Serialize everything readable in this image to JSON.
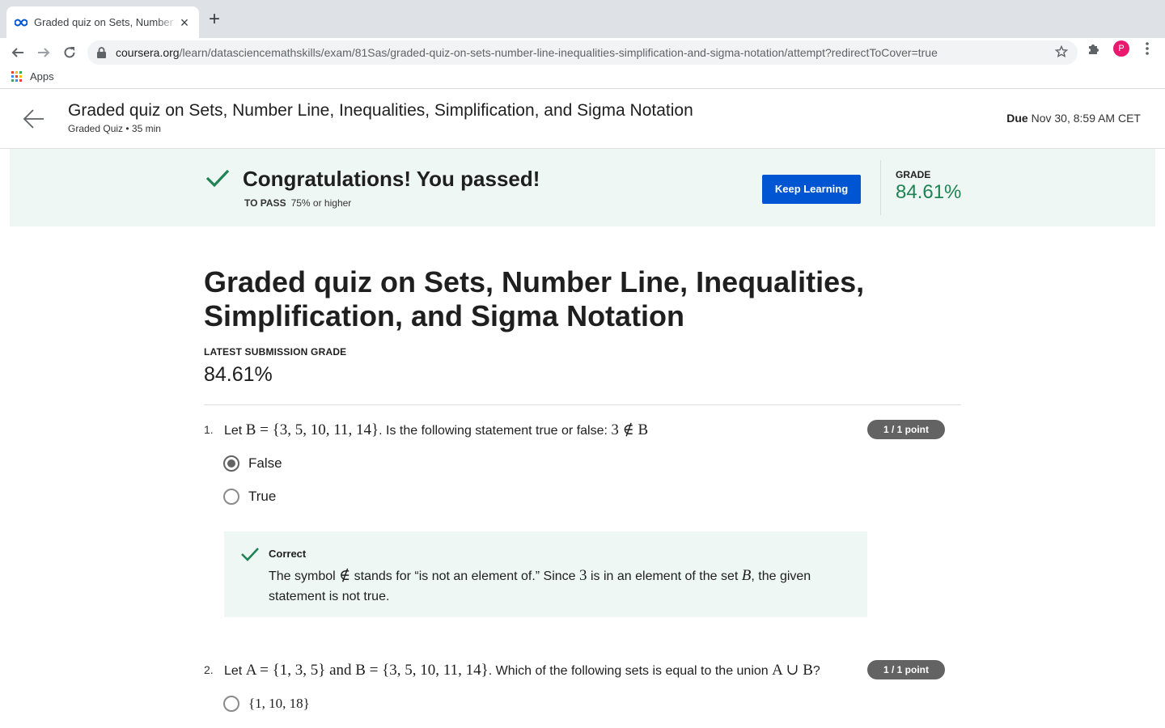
{
  "browser": {
    "tab_title": "Graded quiz on Sets, Number Line, Inequalities, Simplification, and Sigma Notation",
    "url_host": "coursera.org",
    "url_path": "/learn/datasciencemathskills/exam/81Sas/graded-quiz-on-sets-number-line-inequalities-simplification-and-sigma-notation/attempt?redirectToCover=true",
    "bookmark_apps": "Apps",
    "profile_initial": "P",
    "favicon": "coursera-infinity-icon",
    "apps_colors": [
      "#ea4335",
      "#fbbc04",
      "#34a853",
      "#4285f4",
      "#ea4335",
      "#fbbc04",
      "#34a853",
      "#4285f4",
      "#ea4335"
    ]
  },
  "header": {
    "title": "Graded quiz on Sets, Number Line, Inequalities, Simplification, and Sigma Notation",
    "subtitle": "Graded Quiz • 35 min",
    "due_label": "Due",
    "due_value": "Nov 30, 8:59 AM CET"
  },
  "banner": {
    "title": "Congratulations! You passed!",
    "to_pass_label": "TO PASS",
    "to_pass_value": "75% or higher",
    "button_label": "Keep Learning",
    "grade_label": "GRADE",
    "grade_value": "84.61%",
    "accent_color": "#1f8354"
  },
  "main": {
    "title": "Graded quiz on Sets, Number Line, Inequalities, Simplification, and Sigma Notation",
    "latest_grade_label": "LATEST SUBMISSION GRADE",
    "latest_grade_value": "84.61%"
  },
  "questions": [
    {
      "number": "1.",
      "points": "1 / 1 point",
      "prompt_pre": "Let ",
      "prompt_math1": "B = {3, 5, 10, 11, 14}",
      "prompt_mid": ". Is the following statement true or false: ",
      "prompt_math2": "3 ∉ B",
      "options": [
        {
          "label": "False",
          "selected": true
        },
        {
          "label": "True",
          "selected": false
        }
      ],
      "feedback": {
        "label": "Correct",
        "text_1": "The symbol ",
        "math_1": "∉",
        "text_2": " stands for “is not an element of.” Since ",
        "math_2": "3",
        "text_3": " is in an element of the set ",
        "math_3": "B",
        "text_4": ", the given statement is not true."
      }
    },
    {
      "number": "2.",
      "points": "1 / 1 point",
      "prompt_pre": "Let ",
      "prompt_math1": "A = {1, 3, 5}",
      "prompt_and": " and ",
      "prompt_math2": "B = {3, 5, 10, 11, 14}",
      "prompt_mid": ". Which of the following sets is equal to the union ",
      "prompt_math3": "A ∪ B",
      "prompt_end": "?",
      "options": [
        {
          "label": "{1, 10, 18}",
          "selected": false
        }
      ]
    }
  ]
}
